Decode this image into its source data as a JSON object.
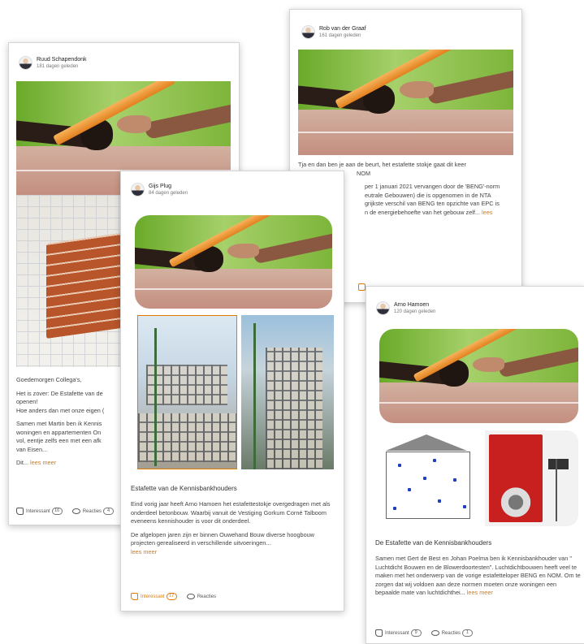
{
  "cards": {
    "ruud": {
      "author": "Ruud Schapendonk",
      "age": "181 dagen geleden",
      "text": [
        "Goedemorgen Collega's,",
        "Het is zover: De Estafette van de",
        "openen!",
        "Hoe anders dan met onze eigen (",
        "Samen met Martin ben ik Kennis",
        "woningen en appartementen On",
        "vol, eentje zelfs een met een afk",
        "van Eisen..."
      ],
      "more_prefix": "Dit...",
      "more": "lees meer",
      "like_label": "Interessant",
      "like_count": "16",
      "comment_label": "Reacties",
      "comment_count": "4"
    },
    "rob": {
      "author": "Rob van der Graaf",
      "age": "161 dagen geleden",
      "text": [
        "Tja en dan ben je aan de beurt, het estafette stokje gaat dit keer",
        "NOM",
        "per 1 januari 2021 vervangen door de 'BENG'-norm",
        "eutrale Gebouwen) die is opgenomen in de NTA",
        "grijkste verschil van BENG ten opzichte van EPC is",
        "n de energiebehoefte van het gebouw zelf..."
      ],
      "more": "lees"
    },
    "gijs": {
      "author": "Gijs Plug",
      "age": "84 dagen geleden",
      "title": "Estafette van de Kennisbankhouders",
      "p1": "Eind vorig jaar heeft Arno Hamoen het estafettestokje overgedragen met als onderdeel betonbouw. Waarbij vanuit de Vestiging Gorkum Corné Talboom eveneens kennishouder is voor dit onderdeel.",
      "p2": "De afgelopen jaren zijn er binnen Ouwehand Bouw diverse hoogbouw projecten gerealiseerd in verschillende uitvoeringen...",
      "more": "lees meer",
      "like_label": "Interessant",
      "like_count": "17",
      "comment_label": "Reacties"
    },
    "arno": {
      "author": "Arno Hamoen",
      "age": "120 dagen geleden",
      "title": "De Estafette van de Kennisbankhouders",
      "p1": "Samen met Gert de Best en Johan Poelma ben ik Kennisbankhouder van \" Luchtdicht Bouwen en de Blowerdoortesten\". Luchtdichtbouwen heeft veel te maken met het onderwerp van de vorige estafetteloper BENG en NOM. Om te zorgen dat wij voldoen aan deze normen moeten onze woningen een bepaalde mate van luchtdichthei...",
      "more": "lees meer",
      "like_label": "Interessant",
      "like_count": "9",
      "comment_label": "Reacties",
      "comment_count": "1"
    }
  },
  "colors": {
    "accent": "#e07b00",
    "card_border": "#d4d4d4"
  },
  "icons": {
    "like": "thumbs-up-icon",
    "comment": "speech-bubble-icon"
  }
}
